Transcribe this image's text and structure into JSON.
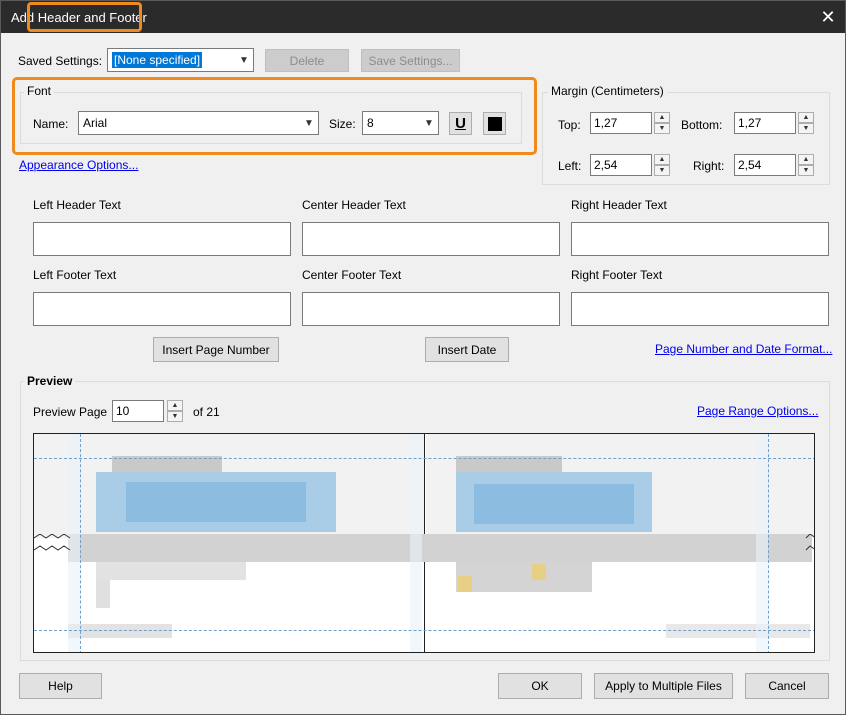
{
  "window": {
    "title": "Add Header and Footer",
    "close_symbol": "✕"
  },
  "saved_settings": {
    "label": "Saved Settings:",
    "value": "[None specified]",
    "delete_label": "Delete",
    "save_settings_label": "Save Settings..."
  },
  "font": {
    "group_title": "Font",
    "name_label": "Name:",
    "name_value": "Arial",
    "size_label": "Size:",
    "size_value": "8",
    "underline_glyph": "U"
  },
  "appearance_link": "Appearance Options...",
  "margin": {
    "group_title": "Margin (Centimeters)",
    "top_label": "Top:",
    "top_value": "1,27",
    "bottom_label": "Bottom:",
    "bottom_value": "1,27",
    "left_label": "Left:",
    "left_value": "2,54",
    "right_label": "Right:",
    "right_value": "2,54"
  },
  "header_fields": {
    "left_label": "Left Header Text",
    "center_label": "Center Header Text",
    "right_label": "Right Header Text"
  },
  "footer_fields": {
    "left_label": "Left Footer Text",
    "center_label": "Center Footer Text",
    "right_label": "Right Footer Text"
  },
  "insert": {
    "page_number_label": "Insert Page Number",
    "date_label": "Insert Date",
    "format_link": "Page Number and Date Format..."
  },
  "preview": {
    "group_title": "Preview",
    "page_label": "Preview Page",
    "page_value": "10",
    "of_label": "of 21",
    "range_link": "Page Range Options..."
  },
  "footer_buttons": {
    "help": "Help",
    "ok": "OK",
    "apply_multiple": "Apply to Multiple Files",
    "cancel": "Cancel"
  },
  "colors": {
    "highlight": "#f08a1c",
    "font_color": "#000000",
    "link": "#0000ee"
  }
}
